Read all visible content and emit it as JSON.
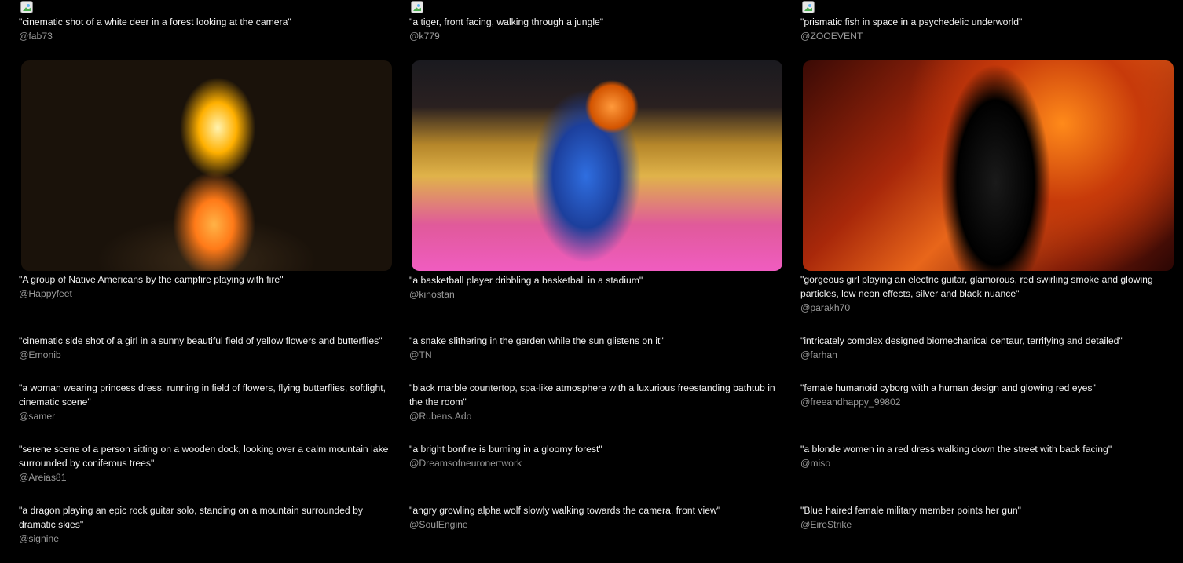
{
  "columns": [
    {
      "top": {
        "prompt": "\"cinematic shot of a white deer in a forest looking at the camera\"",
        "author": "@fab73"
      },
      "featured": {
        "image_alt": "A group of Native Americans by the campfire playing with fire",
        "prompt": "\"A group of Native Americans by the campfire playing with fire\"",
        "author": "@Happyfeet"
      },
      "items": [
        {
          "prompt": "\"cinematic side shot of a girl in a sunny beautiful field of yellow flowers and butterflies\"",
          "author": "@Emonib"
        },
        {
          "prompt": "\"a woman wearing princess dress, running in field of flowers, flying butterflies, softlight, cinematic scene\"",
          "author": "@samer"
        },
        {
          "prompt": "\"serene scene of a person sitting on a wooden dock, looking over a calm mountain lake surrounded by coniferous trees\"",
          "author": "@Areias81"
        },
        {
          "prompt": "\"a dragon playing an epic rock guitar solo, standing on a mountain surrounded by dramatic skies\"",
          "author": "@signine"
        }
      ]
    },
    {
      "top": {
        "prompt": "\"a tiger, front facing, walking through a jungle\"",
        "author": "@k779"
      },
      "featured": {
        "image_alt": "a basketball player dribbling a basketball in a stadium",
        "prompt": "\"a basketball player dribbling a basketball in a stadium\"",
        "author": "@kinostan"
      },
      "items": [
        {
          "prompt": "\"a snake slithering in the garden while the sun glistens on it\"",
          "author": "@TN"
        },
        {
          "prompt": "\"black marble countertop, spa-like atmosphere with a luxurious freestanding bathtub in the the room\"",
          "author": "@Rubens.Ado"
        },
        {
          "prompt": "\"a bright bonfire is burning in a gloomy forest\"",
          "author": "@Dreamsofneuronertwork"
        },
        {
          "prompt": "\"angry growling alpha wolf slowly walking towards the camera, front view\"",
          "author": "@SoulEngine"
        }
      ]
    },
    {
      "top": {
        "prompt": "\"prismatic fish in space in a psychedelic underworld\"",
        "author": "@ZOOEVENT"
      },
      "featured": {
        "image_alt": "gorgeous girl playing an electric guitar",
        "prompt": "\"gorgeous girl playing an electric guitar, glamorous, red swirling smoke and glowing particles, low neon effects, silver and black nuance\"",
        "author": "@parakh70"
      },
      "items": [
        {
          "prompt": "\"intricately complex designed biomechanical centaur, terrifying and detailed\"",
          "author": "@farhan"
        },
        {
          "prompt": "\"female humanoid cyborg with a human design and glowing red eyes\"",
          "author": "@freeandhappy_99802"
        },
        {
          "prompt": "\"a blonde women in a red dress walking down the street with back facing\"",
          "author": "@miso"
        },
        {
          "prompt": "\"Blue haired female military member points her gun\"",
          "author": "@EireStrike"
        }
      ]
    }
  ]
}
